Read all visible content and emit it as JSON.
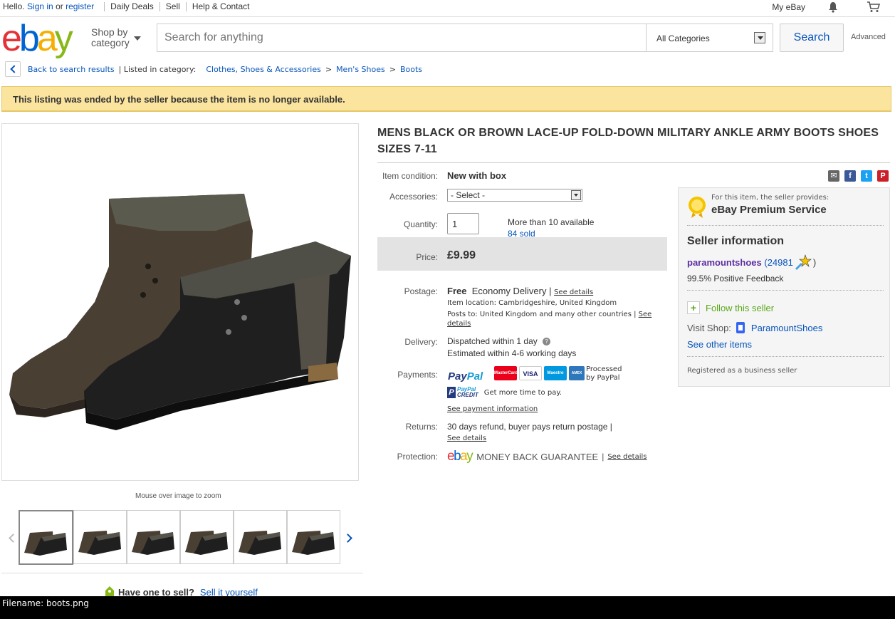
{
  "topbar": {
    "hello": "Hello.",
    "sign_in": "Sign in",
    "or": "or",
    "register": "register",
    "daily_deals": "Daily Deals",
    "sell": "Sell",
    "help_contact": "Help & Contact",
    "my_ebay": "My eBay"
  },
  "header": {
    "logo": [
      "e",
      "b",
      "a",
      "y"
    ],
    "shop_by_line1": "Shop by",
    "shop_by_line2": "category",
    "search_placeholder": "Search for anything",
    "category": "All Categories",
    "search_button": "Search",
    "advanced": "Advanced"
  },
  "breadcrumb": {
    "back": "Back to search results",
    "listed_in": "| Listed in category:",
    "path": [
      "Clothes, Shoes & Accessories",
      "Men's Shoes",
      "Boots"
    ]
  },
  "banner": "This listing was ended by the seller because the item is no longer available.",
  "gallery": {
    "zoom_hint": "Mouse over image to zoom",
    "thumb_count": 6
  },
  "sell_own": {
    "question": "Have one to sell?",
    "link": "Sell it yourself"
  },
  "item": {
    "title": "MENS BLACK OR BROWN LACE-UP FOLD-DOWN MILITARY ANKLE ARMY BOOTS SHOES SIZES 7-11",
    "condition_label": "Item condition:",
    "condition": "New with box",
    "accessories_label": "Accessories:",
    "accessories_value": "- Select -",
    "quantity_label": "Quantity:",
    "quantity": "1",
    "available": "More than 10 available",
    "sold": "84 sold",
    "price_label": "Price:",
    "price": "£9.99",
    "postage_label": "Postage:",
    "postage_free": "Free",
    "postage_service": "Economy Delivery |",
    "see_details": "See details",
    "item_location": "Item location:  Cambridgeshire, United Kingdom",
    "posts_to": "Posts to:  United Kingdom and many other countries |",
    "see": "See",
    "details": "details",
    "delivery_label": "Delivery:",
    "dispatched": "Dispatched within 1 day",
    "estimated": "Estimated within 4-6 working days",
    "payments_label": "Payments:",
    "paypal": [
      "Pay",
      "Pal"
    ],
    "cards": [
      "MasterCard",
      "VISA",
      "Maestro",
      "AMEX"
    ],
    "processed": "Processed",
    "by_paypal": "by PayPal",
    "credit_line1": "PayPal",
    "credit_line2": "CREDIT",
    "more_time": "Get more time to pay.",
    "see_payment": "See payment information",
    "returns_label": "Returns:",
    "returns": "30 days refund, buyer pays return postage |",
    "protection_label": "Protection:",
    "mbg": "MONEY BACK GUARANTEE",
    "pipe": "|"
  },
  "seller": {
    "provides": "For this item, the seller provides:",
    "premium": "eBay Premium Service",
    "info_title": "Seller information",
    "name": "paramountshoes",
    "score": "(24981",
    "score_close": ")",
    "feedback": "99.5% Positive Feedback",
    "follow": "Follow this seller",
    "visit_shop": "Visit Shop:",
    "shop_name": "ParamountShoes",
    "see_other": "See other items",
    "registered": "Registered as a business seller"
  },
  "share_icons": [
    {
      "name": "email",
      "color": "#666666"
    },
    {
      "name": "facebook",
      "color": "#3b5998"
    },
    {
      "name": "twitter",
      "color": "#1da1f2"
    },
    {
      "name": "pinterest",
      "color": "#cb2027"
    }
  ],
  "colors": {
    "link": "#0654ba",
    "banner": "#fbe49e",
    "price_bg": "#e3e3e3",
    "seller_name": "#5d2fa0"
  },
  "filebar": "Filename: boots.png"
}
